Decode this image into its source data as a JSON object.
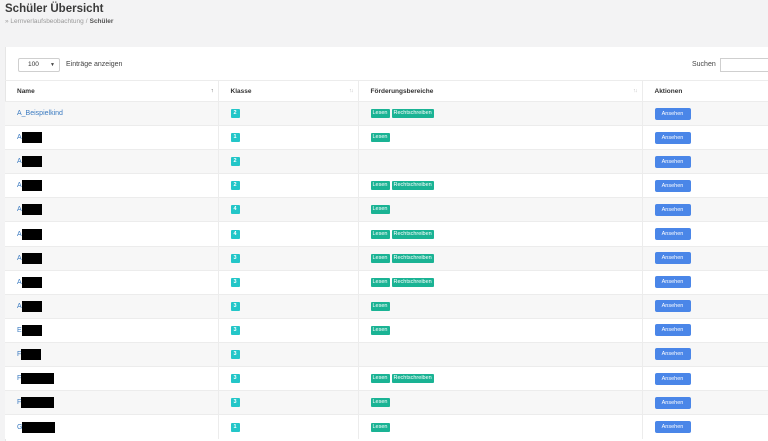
{
  "header": {
    "title": "Schüler Übersicht",
    "breadcrumb": {
      "parent": "Lernverlaufsbeobachtung",
      "separator": "/",
      "current": "Schüler"
    }
  },
  "table_controls": {
    "length_value": "100",
    "length_label": "Einträge anzeigen",
    "search_label": "Suchen",
    "search_value": ""
  },
  "columns": [
    "Name",
    "Klasse",
    "Förderungsbereiche",
    "Aktionen"
  ],
  "rows": [
    {
      "name": "A_Beispielkind",
      "redact_w": 0,
      "klasse": "2",
      "tags": [
        "Lesen",
        "Rechtschreiben"
      ],
      "action": "Ansehen"
    },
    {
      "name": "A",
      "redact_w": 20,
      "klasse": "1",
      "tags": [
        "Lesen"
      ],
      "action": "Ansehen"
    },
    {
      "name": "A",
      "redact_w": 20,
      "klasse": "2",
      "tags": [],
      "action": "Ansehen"
    },
    {
      "name": "A",
      "redact_w": 20,
      "klasse": "2",
      "tags": [
        "Lesen",
        "Rechtschreiben"
      ],
      "action": "Ansehen"
    },
    {
      "name": "A",
      "redact_w": 20,
      "klasse": "4",
      "tags": [
        "Lesen"
      ],
      "action": "Ansehen"
    },
    {
      "name": "A",
      "redact_w": 20,
      "klasse": "4",
      "tags": [
        "Lesen",
        "Rechtschreiben"
      ],
      "action": "Ansehen"
    },
    {
      "name": "A",
      "redact_w": 20,
      "klasse": "3",
      "tags": [
        "Lesen",
        "Rechtschreiben"
      ],
      "action": "Ansehen"
    },
    {
      "name": "A",
      "redact_w": 20,
      "klasse": "3",
      "tags": [
        "Lesen",
        "Rechtschreiben"
      ],
      "action": "Ansehen"
    },
    {
      "name": "A",
      "redact_w": 20,
      "klasse": "3",
      "tags": [
        "Lesen"
      ],
      "action": "Ansehen"
    },
    {
      "name": "E",
      "redact_w": 20,
      "klasse": "3",
      "tags": [
        "Lesen"
      ],
      "action": "Ansehen"
    },
    {
      "name": "F",
      "redact_w": 20,
      "klasse": "3",
      "tags": [],
      "action": "Ansehen"
    },
    {
      "name": "F",
      "redact_w": 33,
      "klasse": "3",
      "tags": [
        "Lesen",
        "Rechtschreiben"
      ],
      "action": "Ansehen"
    },
    {
      "name": "F",
      "redact_w": 33,
      "klasse": "3",
      "tags": [
        "Lesen"
      ],
      "action": "Ansehen"
    },
    {
      "name": "G",
      "redact_w": 33,
      "klasse": "1",
      "tags": [
        "Lesen"
      ],
      "action": "Ansehen"
    }
  ],
  "colors": {
    "klasse_badge": "#23c6c8",
    "tag": "#1ab394",
    "button": "#4a86e8",
    "link": "#3a7ac0"
  }
}
